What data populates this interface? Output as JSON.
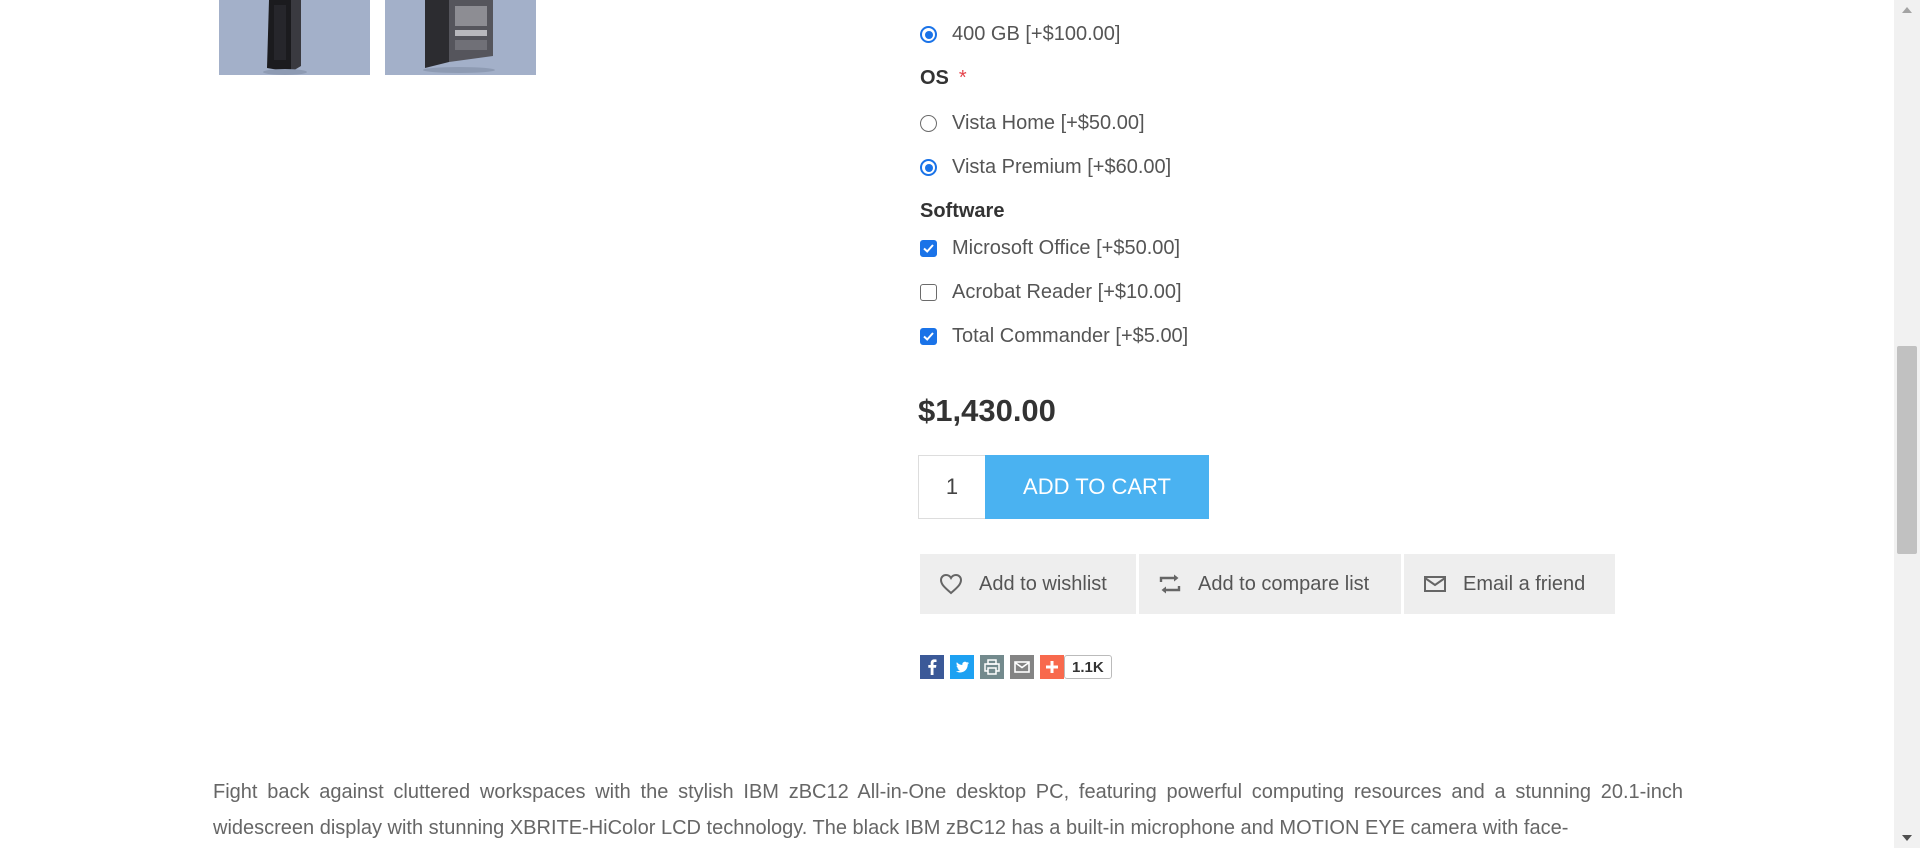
{
  "gallery": {
    "thumbnails": [
      "pc-front-thumbnail",
      "pc-open-case-thumbnail"
    ]
  },
  "hdd": {
    "options": [
      {
        "label": "400 GB [+$100.00]",
        "selected": true
      }
    ]
  },
  "os": {
    "title": "OS",
    "required_mark": "*",
    "options": [
      {
        "label": "Vista Home [+$50.00]",
        "selected": false
      },
      {
        "label": "Vista Premium [+$60.00]",
        "selected": true
      }
    ]
  },
  "software": {
    "title": "Software",
    "options": [
      {
        "label": "Microsoft Office [+$50.00]",
        "checked": true
      },
      {
        "label": "Acrobat Reader [+$10.00]",
        "checked": false
      },
      {
        "label": "Total Commander [+$5.00]",
        "checked": true
      }
    ]
  },
  "price": "$1,430.00",
  "cart": {
    "quantity": "1",
    "add_label": "ADD TO CART"
  },
  "actions": {
    "wishlist": "Add to wishlist",
    "compare": "Add to compare list",
    "email": "Email a friend"
  },
  "share": {
    "icons": [
      "facebook-icon",
      "twitter-icon",
      "print-icon",
      "email-icon",
      "addthis-plus-icon"
    ],
    "count": "1.1K"
  },
  "description": "Fight back against cluttered workspaces with the stylish IBM zBC12 All-in-One desktop PC, featuring powerful computing resources and a stunning 20.1-inch widescreen display with stunning XBRITE-HiColor LCD technology. The black IBM zBC12 has a built-in microphone and MOTION EYE camera with face-",
  "colors": {
    "accent": "#4ab2f1",
    "required": "#e4434b",
    "control_checked": "#1a73e8",
    "action_bg": "#eeeeee"
  }
}
